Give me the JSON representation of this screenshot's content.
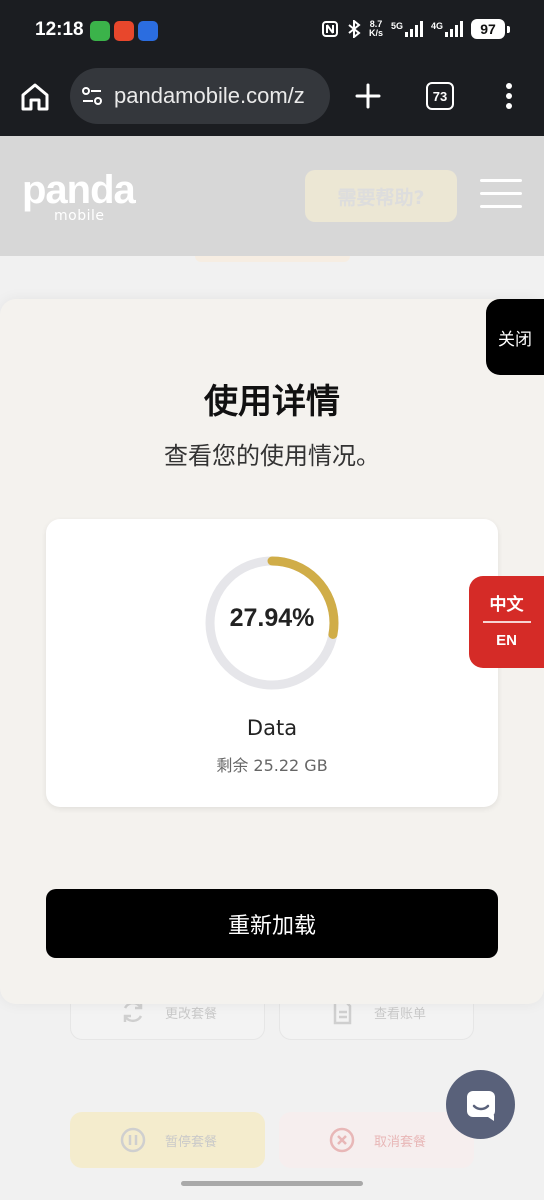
{
  "status_bar": {
    "time": "12:18",
    "net_speed_top": "8.7",
    "net_speed_unit": "K/s",
    "sig1_label": "5G",
    "sig2_label": "4G",
    "battery": "97"
  },
  "browser": {
    "url": "pandamobile.com/z",
    "tab_count": "73"
  },
  "header": {
    "logo_main": "panda",
    "logo_sub": "mobile",
    "help_button": "需要帮助?"
  },
  "background_actions": [
    {
      "label": "更改套餐",
      "icon": "refresh-icon"
    },
    {
      "label": "查看账单",
      "icon": "document-icon"
    },
    {
      "label": "暂停套餐",
      "icon": "pause-icon"
    },
    {
      "label": "取消套餐",
      "icon": "cancel-icon"
    }
  ],
  "modal": {
    "close_label": "关闭",
    "title": "使用详情",
    "subtitle": "查看您的使用情况。",
    "usage_card": {
      "percent_text": "27.94%",
      "percent_value": 27.94,
      "label": "Data",
      "remaining": "剩余 25.22 GB"
    },
    "reload_button": "重新加载"
  },
  "language_switch": {
    "zh": "中文",
    "en": "EN"
  },
  "colors": {
    "ring_progress": "#d0ad48",
    "ring_track": "#e6e6ea",
    "language_tab": "#d52b27",
    "chat_button": "#59617a"
  }
}
